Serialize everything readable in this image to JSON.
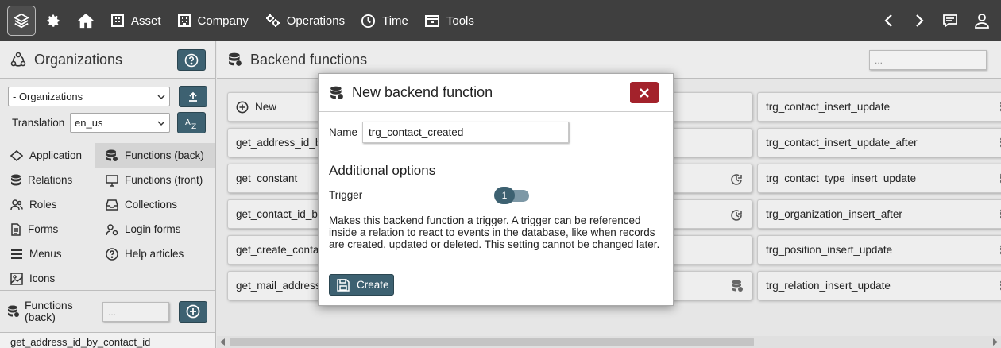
{
  "topbar": {
    "items": [
      {
        "label": "Asset",
        "icon": "asset-icon"
      },
      {
        "label": "Company",
        "icon": "company-icon"
      },
      {
        "label": "Operations",
        "icon": "operations-icon"
      },
      {
        "label": "Time",
        "icon": "clock-icon"
      },
      {
        "label": "Tools",
        "icon": "tools-icon"
      }
    ]
  },
  "sidebar": {
    "title": "Organizations",
    "module_select": "- Organizations",
    "translation_label": "Translation",
    "translation_select": "en_us",
    "nav_left": [
      "Application",
      "Relations",
      "Roles",
      "Forms",
      "Menus",
      "Icons"
    ],
    "nav_right": [
      "Functions (back)",
      "Functions (front)",
      "Collections",
      "Login forms",
      "Help articles"
    ],
    "functions_label": "Functions (back)",
    "search_placeholder": "...",
    "list_first": "get_address_id_by_contact_id"
  },
  "main": {
    "title": "Backend functions",
    "search_placeholder": "...",
    "new_label": "New",
    "col1": [
      "get_address_id_by",
      "get_constant",
      "get_contact_id_by",
      "get_create_contac",
      "get_mail_addresse"
    ],
    "col3": [
      "trg_contact_insert_update",
      "trg_contact_insert_update_after",
      "trg_contact_type_insert_update",
      "trg_organization_insert_after",
      "trg_position_insert_update",
      "trg_relation_insert_update"
    ]
  },
  "dialog": {
    "title": "New backend function",
    "name_label": "Name",
    "name_value": "trg_contact_created",
    "section_title": "Additional options",
    "trigger_label": "Trigger",
    "trigger_value": "1",
    "description": "Makes this backend function a trigger. A trigger can be referenced inside a relation to react to events in the database, like when records are created, updated or deleted. This setting cannot be changed later.",
    "create_label": "Create"
  },
  "colors": {
    "topbar": "#3f3f3f",
    "accent": "#3d6171",
    "close": "#a3222b"
  }
}
